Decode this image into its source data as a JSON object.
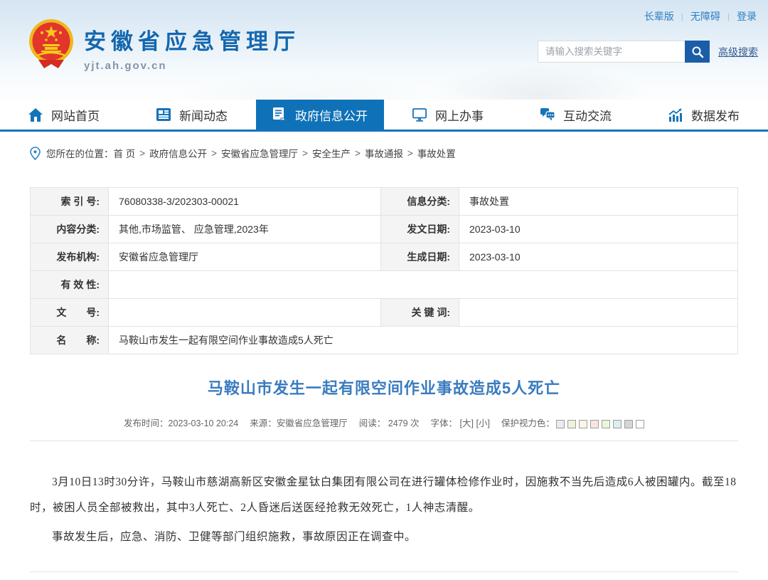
{
  "topbar": {
    "links": [
      {
        "label": "长辈版"
      },
      {
        "label": "无障碍"
      },
      {
        "label": "登录"
      }
    ]
  },
  "header": {
    "site_name": "安徽省应急管理厅",
    "site_url": "yjt.ah.gov.cn",
    "search": {
      "placeholder": "请输入搜索关键字",
      "advanced_label": "高级搜索"
    }
  },
  "nav": {
    "items": [
      {
        "label": "网站首页",
        "icon": "home-icon",
        "active": false
      },
      {
        "label": "新闻动态",
        "icon": "news-icon",
        "active": false
      },
      {
        "label": "政府信息公开",
        "icon": "document-icon",
        "active": true
      },
      {
        "label": "网上办事",
        "icon": "monitor-icon",
        "active": false
      },
      {
        "label": "互动交流",
        "icon": "chat-icon",
        "active": false
      },
      {
        "label": "数据发布",
        "icon": "chart-icon",
        "active": false
      }
    ]
  },
  "breadcrumb": {
    "prefix": "您所在的位置：",
    "separator": ">",
    "items": [
      "首 页",
      "政府信息公开",
      "安徽省应急管理厅",
      "安全生产",
      "事故通报",
      "事故处置"
    ]
  },
  "info_table": {
    "index_label": "索 引 号:",
    "index_value": "76080338-3/202303-00021",
    "info_class_label": "信息分类:",
    "info_class_value": "事故处置",
    "content_class_label": "内容分类:",
    "content_class_value": "其他,市场监管、 应急管理,2023年",
    "issue_date_label": "发文日期:",
    "issue_date_value": "2023-03-10",
    "publisher_label": "发布机构:",
    "publisher_value": "安徽省应急管理厅",
    "create_date_label": "生成日期:",
    "create_date_value": "2023-03-10",
    "validity_label": "有 效 性:",
    "validity_value": "",
    "doc_no_label": "文　　号:",
    "doc_no_value": "",
    "keywords_label": "关 键 词:",
    "keywords_value": "",
    "name_label": "名　　称:",
    "name_value": "马鞍山市发生一起有限空间作业事故造成5人死亡"
  },
  "article": {
    "title": "马鞍山市发生一起有限空间作业事故造成5人死亡",
    "meta": {
      "publish": "发布时间：2023-03-10 20:24",
      "source": "来源：安徽省应急管理厅",
      "views": "阅读：  2479  次",
      "font_label": "字体：",
      "font_large": "[大]",
      "font_small": "[小]",
      "eye_label": "保护视力色：",
      "eye_colors": [
        "#e9ebf1",
        "#eff1da",
        "#fdf4e4",
        "#fae4e0",
        "#eaf5dc",
        "#daf0ea",
        "#d6d6d6",
        "#ffffff"
      ]
    },
    "paragraphs": [
      "3月10日13时30分许，马鞍山市慈湖高新区安徽金星钛白集团有限公司在进行罐体检修作业时，因施救不当先后造成6人被困罐内。截至18时，被困人员全部被救出，其中3人死亡、2人昏迷后送医经抢救无效死亡，1人神志清醒。",
      "事故发生后，应急、消防、卫健等部门组织施救，事故原因正在调查中。"
    ]
  },
  "colors": {
    "primary_blue": "#1474b9",
    "active_tab": "#0f72b8",
    "title_blue": "#3a7cbf",
    "logo_blue": "#1467ae"
  }
}
